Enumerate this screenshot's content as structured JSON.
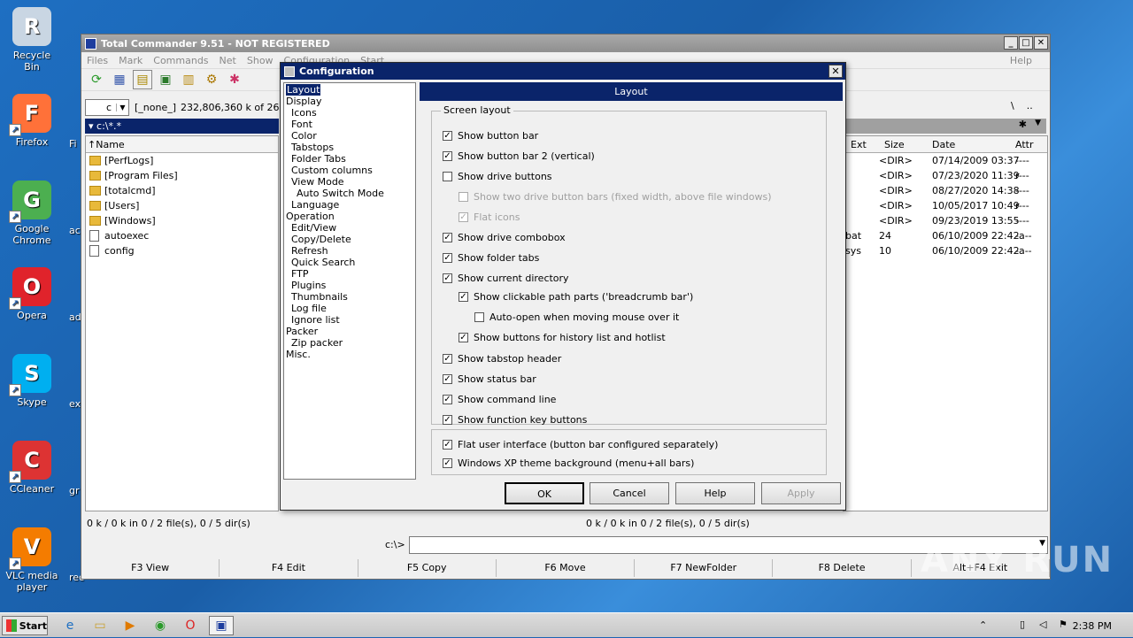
{
  "desktop": {
    "icons": [
      {
        "label": "Recycle Bin",
        "icon": "recycle-bin-icon",
        "color": "#c9d6e3"
      },
      {
        "label": "Firefox",
        "icon": "firefox-icon",
        "color": "#ff7139"
      },
      {
        "label": "Google Chrome",
        "icon": "chrome-icon",
        "color": "#4caf50"
      },
      {
        "label": "Opera",
        "icon": "opera-icon",
        "color": "#e0232b"
      },
      {
        "label": "Skype",
        "icon": "skype-icon",
        "color": "#00aff0"
      },
      {
        "label": "CCleaner",
        "icon": "ccleaner-icon",
        "color": "#d33"
      },
      {
        "label": "VLC media player",
        "icon": "vlc-icon",
        "color": "#f47c00"
      }
    ],
    "partial_labels": [
      "Fi",
      "ac",
      "ad",
      "ex",
      "gr",
      "rec"
    ]
  },
  "main_window": {
    "title": "Total Commander 9.51 - NOT REGISTERED",
    "menu": [
      "Files",
      "Mark",
      "Commands",
      "Net",
      "Show",
      "Configuration",
      "Start"
    ],
    "help": "Help",
    "drive": "c",
    "drive_info_name": "[_none_]",
    "drive_info": "232,806,360 k of 268,3",
    "path_left": "c:\\*.*",
    "left_panel": {
      "header_name": "Name",
      "rows": [
        {
          "name": "[PerfLogs]",
          "type": "folder"
        },
        {
          "name": "[Program Files]",
          "type": "folder"
        },
        {
          "name": "[totalcmd]",
          "type": "folder"
        },
        {
          "name": "[Users]",
          "type": "folder"
        },
        {
          "name": "[Windows]",
          "type": "folder"
        },
        {
          "name": "autoexec",
          "type": "file"
        },
        {
          "name": "config",
          "type": "file"
        }
      ]
    },
    "right_panel": {
      "nav_root": "\\",
      "nav_up": "..",
      "headers": {
        "ext": "Ext",
        "size": "Size",
        "date": "Date",
        "attr": "Attr"
      },
      "rows": [
        {
          "ext": "",
          "size": "<DIR>",
          "date": "07/14/2009 03:37",
          "attr": "----"
        },
        {
          "ext": "",
          "size": "<DIR>",
          "date": "07/23/2020 11:39",
          "attr": "r---"
        },
        {
          "ext": "",
          "size": "<DIR>",
          "date": "08/27/2020 14:38",
          "attr": "----"
        },
        {
          "ext": "",
          "size": "<DIR>",
          "date": "10/05/2017 10:49",
          "attr": "r---"
        },
        {
          "ext": "",
          "size": "<DIR>",
          "date": "09/23/2019 13:55",
          "attr": "----"
        },
        {
          "ext": "bat",
          "size": "24",
          "date": "06/10/2009 22:42",
          "attr": "-a--"
        },
        {
          "ext": "sys",
          "size": "10",
          "date": "06/10/2009 22:42",
          "attr": "-a--"
        }
      ]
    },
    "status_left": "0 k / 0 k in 0 / 2 file(s), 0 / 5 dir(s)",
    "status_right": "0 k / 0 k in 0 / 2 file(s), 0 / 5 dir(s)",
    "cmd_prompt": "c:\\>",
    "fkeys": [
      "F3 View",
      "F4 Edit",
      "F5 Copy",
      "F6 Move",
      "F7 NewFolder",
      "F8 Delete",
      "Alt+F4 Exit"
    ]
  },
  "dialog": {
    "title": "Configuration",
    "tree": [
      {
        "label": "Layout",
        "level": 0,
        "selected": true
      },
      {
        "label": "Display",
        "level": 0
      },
      {
        "label": "Icons",
        "level": 1
      },
      {
        "label": "Font",
        "level": 1
      },
      {
        "label": "Color",
        "level": 1
      },
      {
        "label": "Tabstops",
        "level": 1
      },
      {
        "label": "Folder Tabs",
        "level": 1
      },
      {
        "label": "Custom columns",
        "level": 1
      },
      {
        "label": "View Mode",
        "level": 1
      },
      {
        "label": "Auto Switch Mode",
        "level": 2
      },
      {
        "label": "Language",
        "level": 1
      },
      {
        "label": "Operation",
        "level": 0
      },
      {
        "label": "Edit/View",
        "level": 1
      },
      {
        "label": "Copy/Delete",
        "level": 1
      },
      {
        "label": "Refresh",
        "level": 1
      },
      {
        "label": "Quick Search",
        "level": 1
      },
      {
        "label": "FTP",
        "level": 1
      },
      {
        "label": "Plugins",
        "level": 1
      },
      {
        "label": "Thumbnails",
        "level": 1
      },
      {
        "label": "Log file",
        "level": 1
      },
      {
        "label": "Ignore list",
        "level": 1
      },
      {
        "label": "Packer",
        "level": 0
      },
      {
        "label": "Zip packer",
        "level": 1
      },
      {
        "label": "Misc.",
        "level": 0
      }
    ],
    "page_header": "Layout",
    "group_label": "Screen layout",
    "options": [
      {
        "label": "Show button bar",
        "checked": true
      },
      {
        "label": "Show button bar 2 (vertical)",
        "checked": true
      },
      {
        "label": "Show drive buttons",
        "checked": false
      },
      {
        "label": "Show two drive button bars (fixed width, above file windows)",
        "checked": false,
        "disabled": true
      },
      {
        "label": "Flat icons",
        "checked": true,
        "disabled": true
      },
      {
        "label": "Show drive combobox",
        "checked": true
      },
      {
        "label": "Show folder tabs",
        "checked": true
      },
      {
        "label": "Show current directory",
        "checked": true
      },
      {
        "label": "Show clickable path parts ('breadcrumb bar')",
        "checked": true
      },
      {
        "label": "Auto-open when moving mouse over it",
        "checked": false
      },
      {
        "label": "Show buttons for history list and hotlist",
        "checked": true
      },
      {
        "label": "Show tabstop header",
        "checked": true
      },
      {
        "label": "Show status bar",
        "checked": true
      },
      {
        "label": "Show command line",
        "checked": true
      },
      {
        "label": "Show function key buttons",
        "checked": true
      }
    ],
    "options2": [
      {
        "label": "Flat user interface (button bar configured separately)",
        "checked": true
      },
      {
        "label": "Windows XP theme background (menu+all bars)",
        "checked": true
      }
    ],
    "buttons": {
      "ok": "OK",
      "cancel": "Cancel",
      "help": "Help",
      "apply": "Apply"
    }
  },
  "taskbar": {
    "start": "Start",
    "clock": "2:38 PM"
  },
  "watermark": "ANY RUN"
}
